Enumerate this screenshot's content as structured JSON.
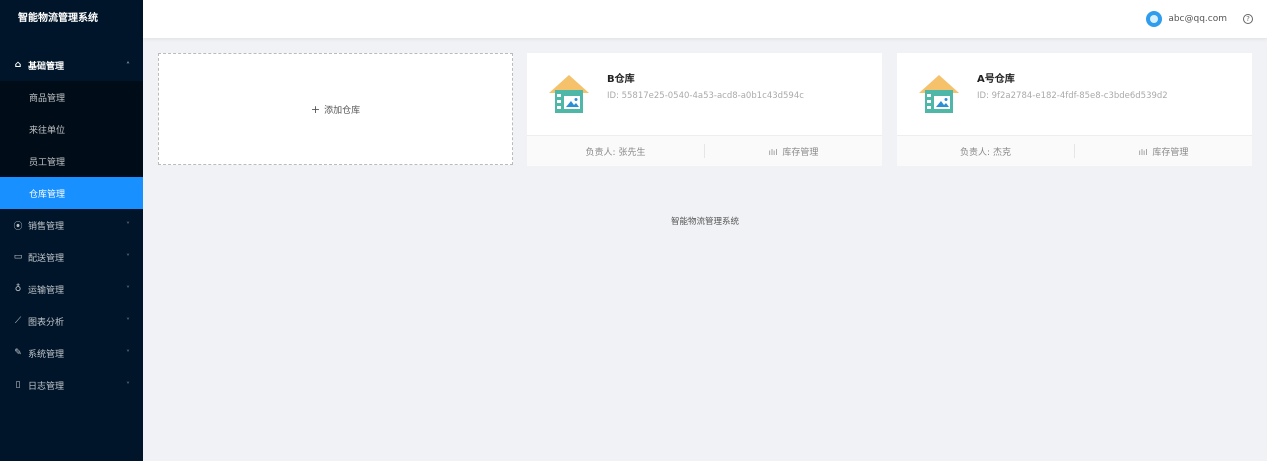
{
  "app": {
    "title": "智能物流管理系统"
  },
  "header": {
    "user_email": "abc@qq.com",
    "help_glyph": "?"
  },
  "sidebar": {
    "groups": [
      {
        "label": "基础管理",
        "icon": "home-icon",
        "glyph": "⌂",
        "expanded": true,
        "arrow": "˄"
      },
      {
        "label": "销售管理",
        "icon": "sales-icon",
        "glyph": "⦿",
        "arrow": "˅"
      },
      {
        "label": "配送管理",
        "icon": "delivery-icon",
        "glyph": "▭",
        "arrow": "˅"
      },
      {
        "label": "运输管理",
        "icon": "transport-icon",
        "glyph": "♁",
        "arrow": "˅"
      },
      {
        "label": "图表分析",
        "icon": "chart-icon",
        "glyph": "⟋",
        "arrow": "˅"
      },
      {
        "label": "系统管理",
        "icon": "tool-icon",
        "glyph": "✎",
        "arrow": "˅"
      },
      {
        "label": "日志管理",
        "icon": "file-icon",
        "glyph": "▯",
        "arrow": "˅"
      }
    ],
    "sub_items": [
      {
        "label": "商品管理"
      },
      {
        "label": "来往单位"
      },
      {
        "label": "员工管理"
      },
      {
        "label": "仓库管理",
        "active": true
      }
    ]
  },
  "add_card": {
    "plus": "+",
    "label": "添加仓库"
  },
  "warehouses": [
    {
      "name": "B仓库",
      "id_text": "ID: 55817e25-0540-4a53-acd8-a0b1c43d594c",
      "manager": "负责人: 张先生",
      "action": "库存管理",
      "action_glyph": "ılıl"
    },
    {
      "name": "A号仓库",
      "id_text": "ID: 9f2a2784-e182-4fdf-85e8-c3bde6d539d2",
      "manager": "负责人: 杰克",
      "action": "库存管理",
      "action_glyph": "ılıl"
    }
  ],
  "footer": {
    "text": "智能物流管理系统"
  },
  "colors": {
    "sidebar_bg": "#001529",
    "active": "#1890ff",
    "roof": "#f5c26b",
    "house": "#4fb7a8"
  }
}
